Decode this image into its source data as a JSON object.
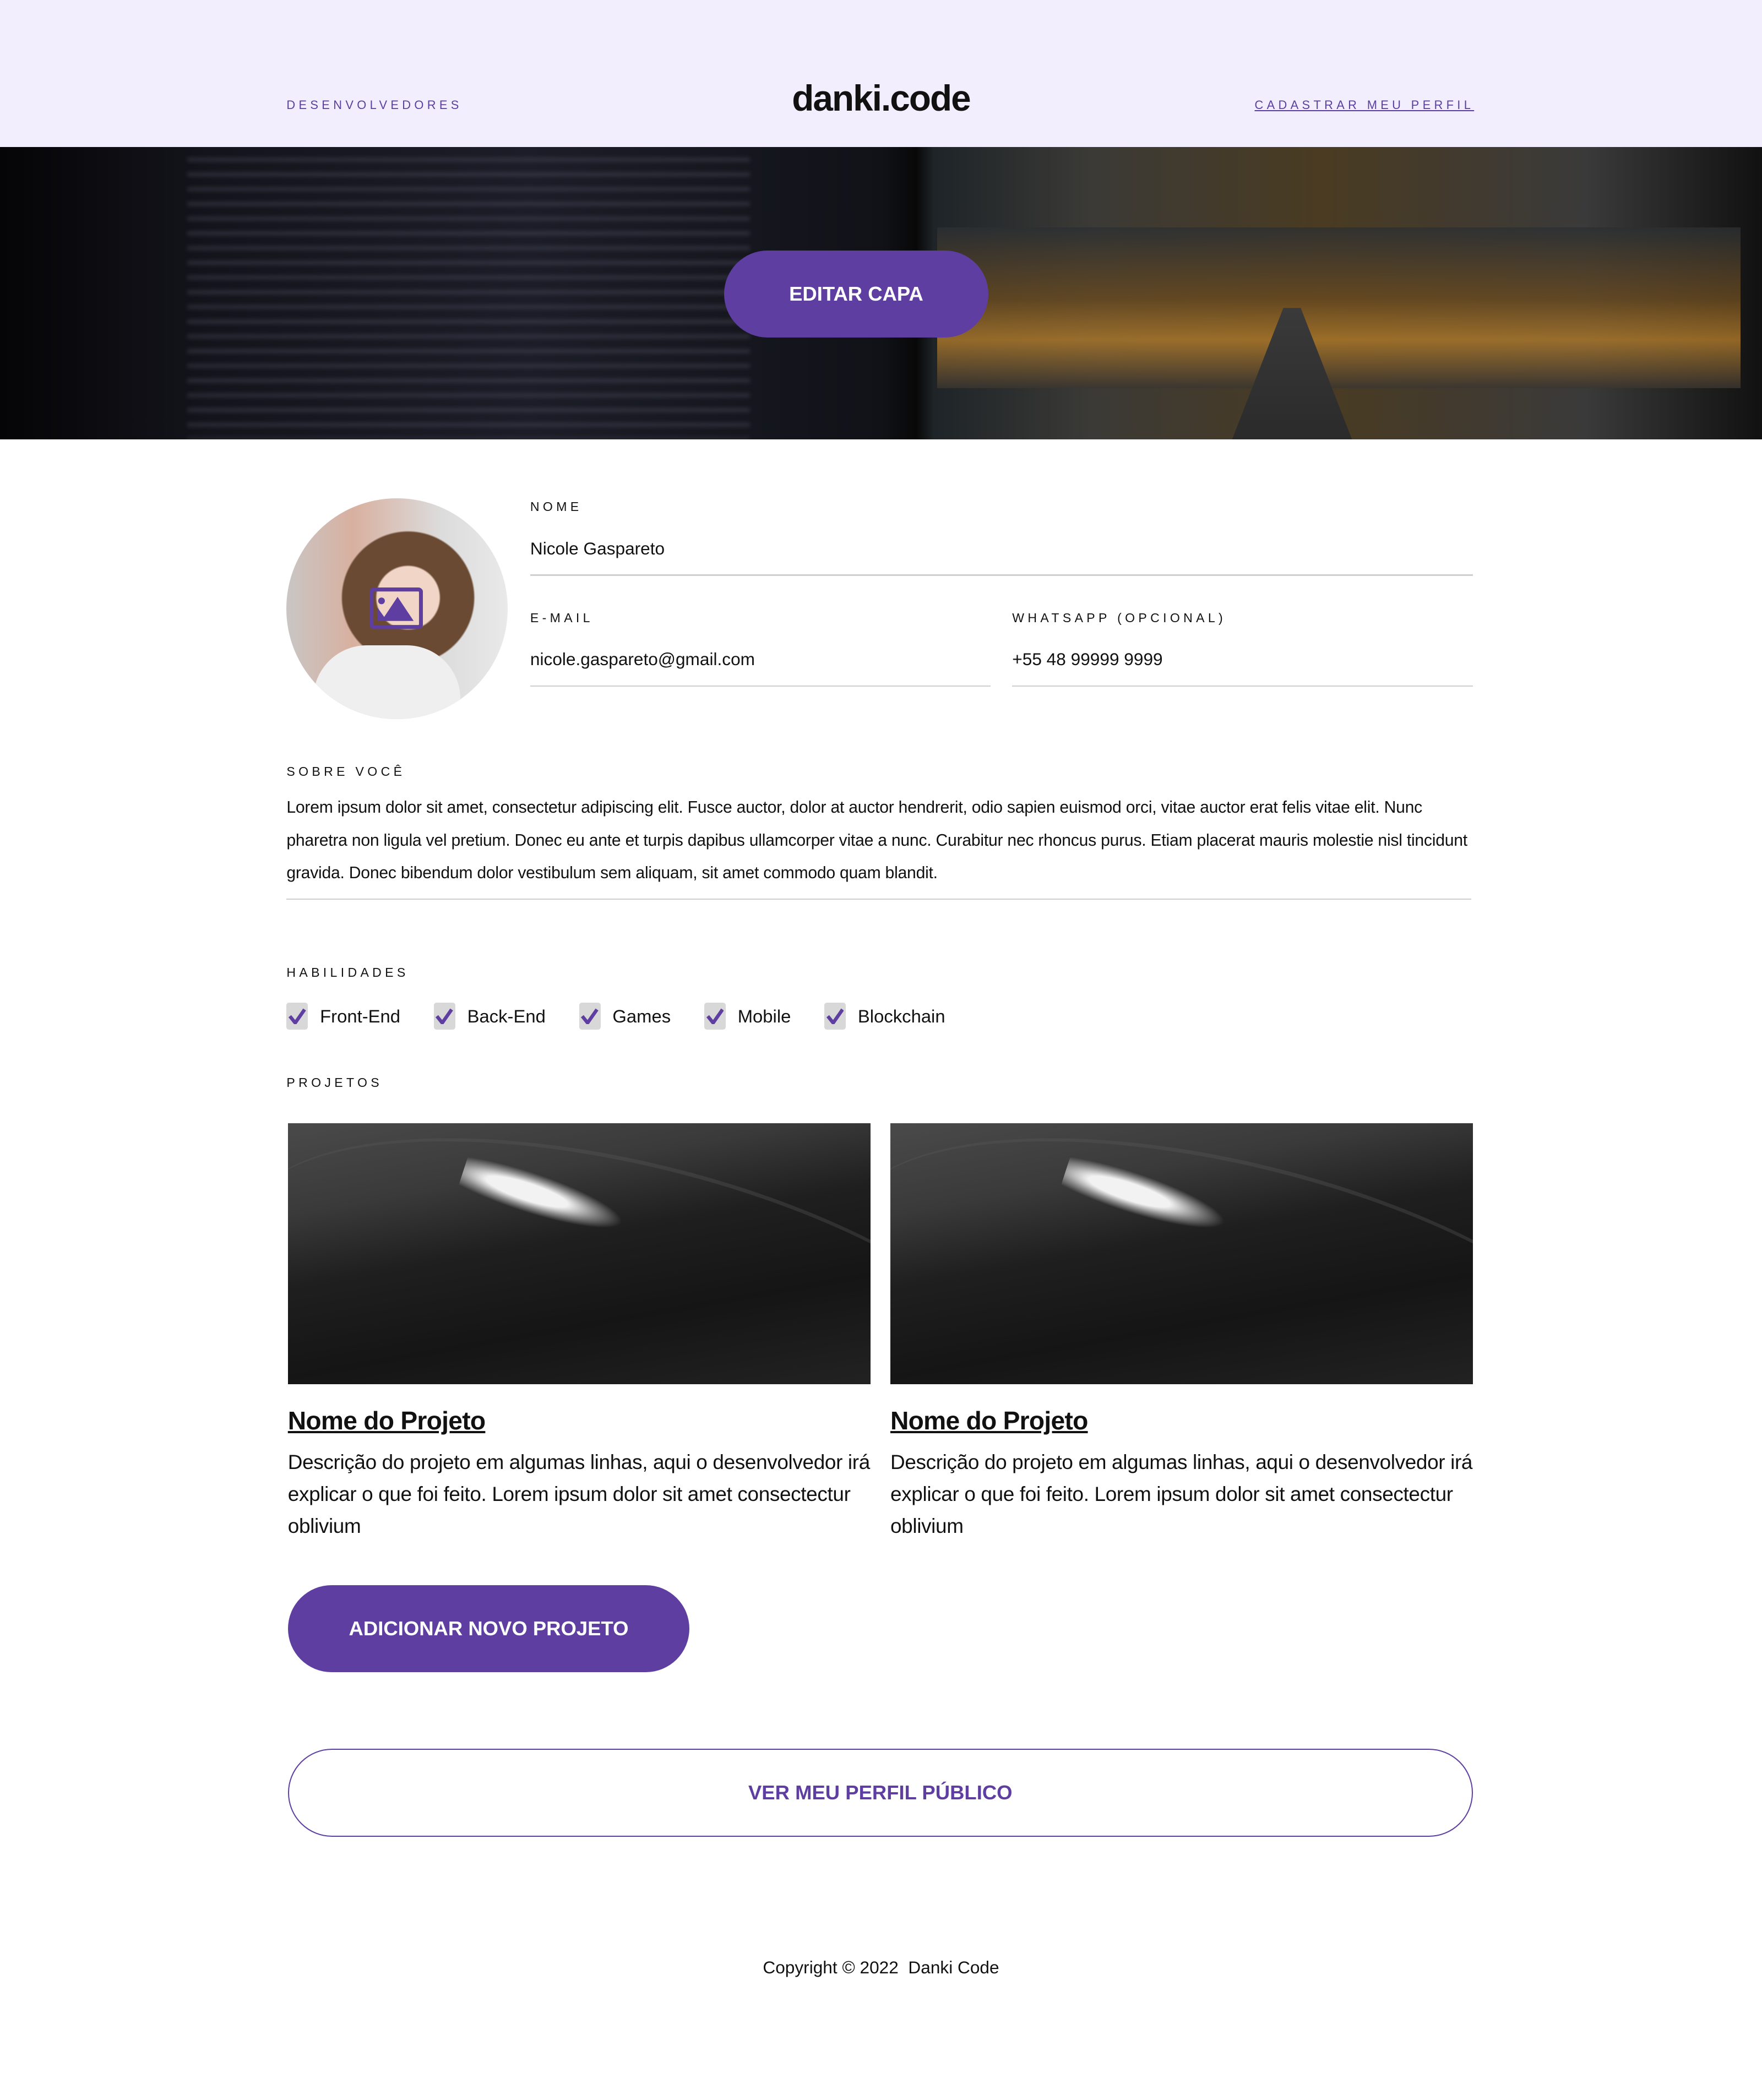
{
  "header": {
    "nav_left": "DESENVOLVEDORES",
    "logo": "danki.code",
    "nav_right": "CADASTRAR MEU PERFIL"
  },
  "hero": {
    "edit_cover_label": "EDITAR CAPA"
  },
  "profile": {
    "name_label": "NOME",
    "name_value": "Nicole Gaspareto",
    "email_label": "E-MAIL",
    "email_value": "nicole.gaspareto@gmail.com",
    "whatsapp_label": "WHATSAPP (OPCIONAL)",
    "whatsapp_value": "+55 48 99999 9999",
    "about_label": "SOBRE VOCÊ",
    "about_value": "Lorem ipsum dolor sit amet, consectetur adipiscing elit. Fusce auctor, dolor at auctor hendrerit, odio sapien euismod orci, vitae auctor erat felis vitae elit. Nunc pharetra non ligula vel pretium. Donec eu ante et turpis dapibus ullamcorper vitae a nunc. Curabitur nec rhoncus purus. Etiam placerat mauris molestie nisl tincidunt gravida. Donec bibendum dolor vestibulum sem aliquam, sit amet commodo quam blandit."
  },
  "skills": {
    "label": "HABILIDADES",
    "items": [
      {
        "label": "Front-End",
        "checked": true
      },
      {
        "label": "Back-End",
        "checked": true
      },
      {
        "label": "Games",
        "checked": true
      },
      {
        "label": "Mobile",
        "checked": true
      },
      {
        "label": "Blockchain",
        "checked": true
      }
    ]
  },
  "projects": {
    "label": "PROJETOS",
    "items": [
      {
        "title": "Nome do Projeto",
        "description": "Descrição do projeto em algumas linhas, aqui o desenvolvedor irá explicar o que foi feito. Lorem ipsum dolor sit amet consectectur oblivium"
      },
      {
        "title": "Nome do Projeto",
        "description": "Descrição do projeto em algumas linhas, aqui o desenvolvedor irá explicar o que foi feito. Lorem ipsum dolor sit amet consectectur oblivium"
      }
    ],
    "add_label": "ADICIONAR NOVO PROJETO"
  },
  "public_profile_label": "VER MEU PERFIL PÚBLICO",
  "footer": {
    "copyright": "Copyright © 2022  Danki Code"
  },
  "colors": {
    "accent": "#5e3ea1",
    "header_bg": "#f2eefe",
    "checkbox_bg": "#d8d8d8",
    "divider": "#cfcfcf"
  }
}
